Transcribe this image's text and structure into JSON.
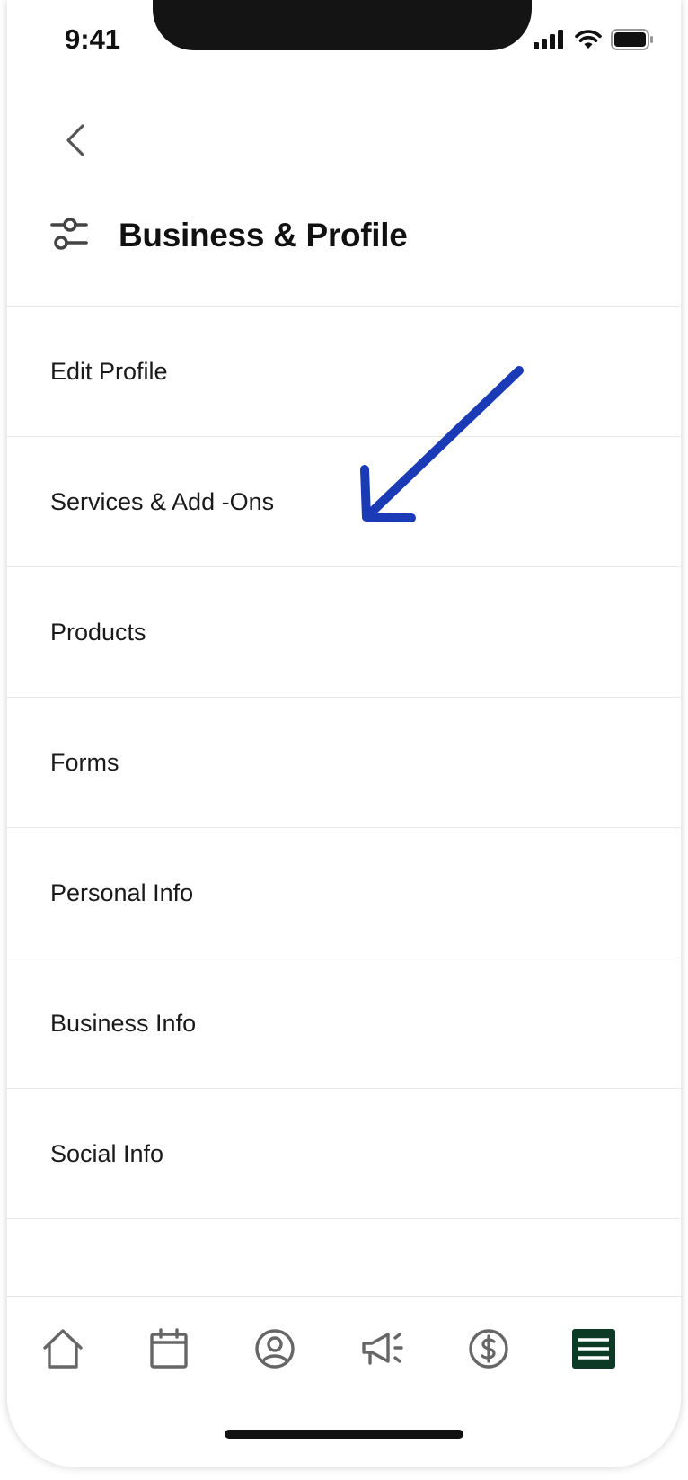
{
  "status_bar": {
    "time": "9:41"
  },
  "header": {
    "title": "Business & Profile"
  },
  "menu": {
    "items": [
      {
        "label": "Edit Profile"
      },
      {
        "label": "Services & Add -Ons"
      },
      {
        "label": "Products"
      },
      {
        "label": "Forms"
      },
      {
        "label": "Personal Info"
      },
      {
        "label": "Business Info"
      },
      {
        "label": "Social Info"
      }
    ]
  },
  "bottom_nav": {
    "items": [
      {
        "icon": "home-icon"
      },
      {
        "icon": "calendar-icon"
      },
      {
        "icon": "user-circle-icon"
      },
      {
        "icon": "megaphone-icon"
      },
      {
        "icon": "dollar-icon"
      },
      {
        "icon": "menu-icon",
        "active": true
      }
    ]
  },
  "colors": {
    "accent": "#0c3a25",
    "annotation_arrow": "#1a3bb5",
    "text": "#1a1a1a",
    "divider": "#e8e8e8"
  }
}
